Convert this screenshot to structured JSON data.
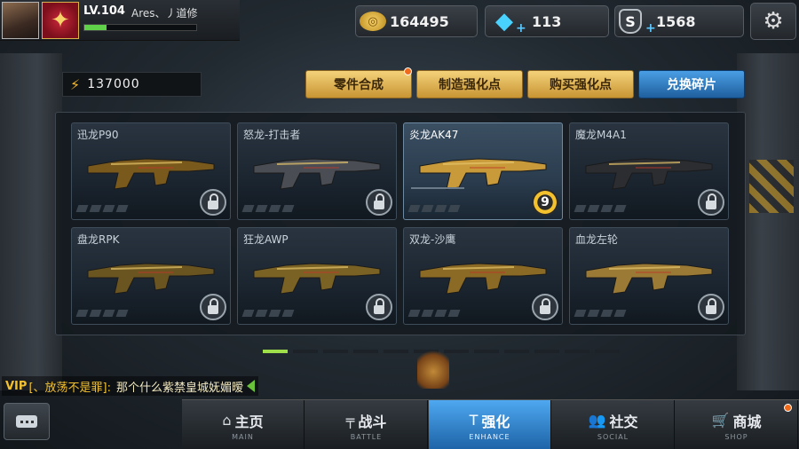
{
  "player": {
    "level": "LV.104",
    "name": "Ares、丿道修",
    "xp_fraction": 0.2
  },
  "currencies": {
    "gold": "164495",
    "diamonds": "113",
    "s_points": "1568",
    "s_icon_label": "S"
  },
  "power": {
    "value": "137000"
  },
  "actions": [
    {
      "label": "零件合成",
      "badge": true
    },
    {
      "label": "制造强化点",
      "badge": false
    },
    {
      "label": "购买强化点",
      "badge": false
    },
    {
      "label": "兑换碎片",
      "badge": false,
      "active": true
    }
  ],
  "weapons": [
    {
      "name": "迅龙P90",
      "locked": true
    },
    {
      "name": "怒龙-打击者",
      "locked": true
    },
    {
      "name": "炎龙AK47",
      "locked": false,
      "selected": true,
      "level": "9"
    },
    {
      "name": "魔龙M4A1",
      "locked": true
    },
    {
      "name": "盘龙RPK",
      "locked": true
    },
    {
      "name": "狂龙AWP",
      "locked": true
    },
    {
      "name": "双龙-沙鹰",
      "locked": true
    },
    {
      "name": "血龙左轮",
      "locked": true
    }
  ],
  "pager": {
    "pages": 12,
    "current": 1
  },
  "chat": {
    "vip": "VIP",
    "sender": "[、放荡不是罪]:",
    "message": "那个什么紫禁皇城妩媚暧"
  },
  "nav": [
    {
      "label": "主页",
      "sub": "MAIN",
      "icon": "home-icon",
      "glyph": "⌂"
    },
    {
      "label": "战斗",
      "sub": "BATTLE",
      "icon": "gun-icon",
      "glyph": "╤"
    },
    {
      "label": "强化",
      "sub": "ENHANCE",
      "icon": "hammer-icon",
      "glyph": "T",
      "active": true
    },
    {
      "label": "社交",
      "sub": "SOCIAL",
      "icon": "people-icon",
      "glyph": "👥"
    },
    {
      "label": "商城",
      "sub": "SHOP",
      "icon": "cart-icon",
      "glyph": "🛒",
      "badge": true
    }
  ],
  "colors": {
    "accent_blue": "#2f7fc9",
    "gold_button": "#e2b357",
    "xp_green": "#5fd24a",
    "badge_orange": "#f06a1a"
  }
}
